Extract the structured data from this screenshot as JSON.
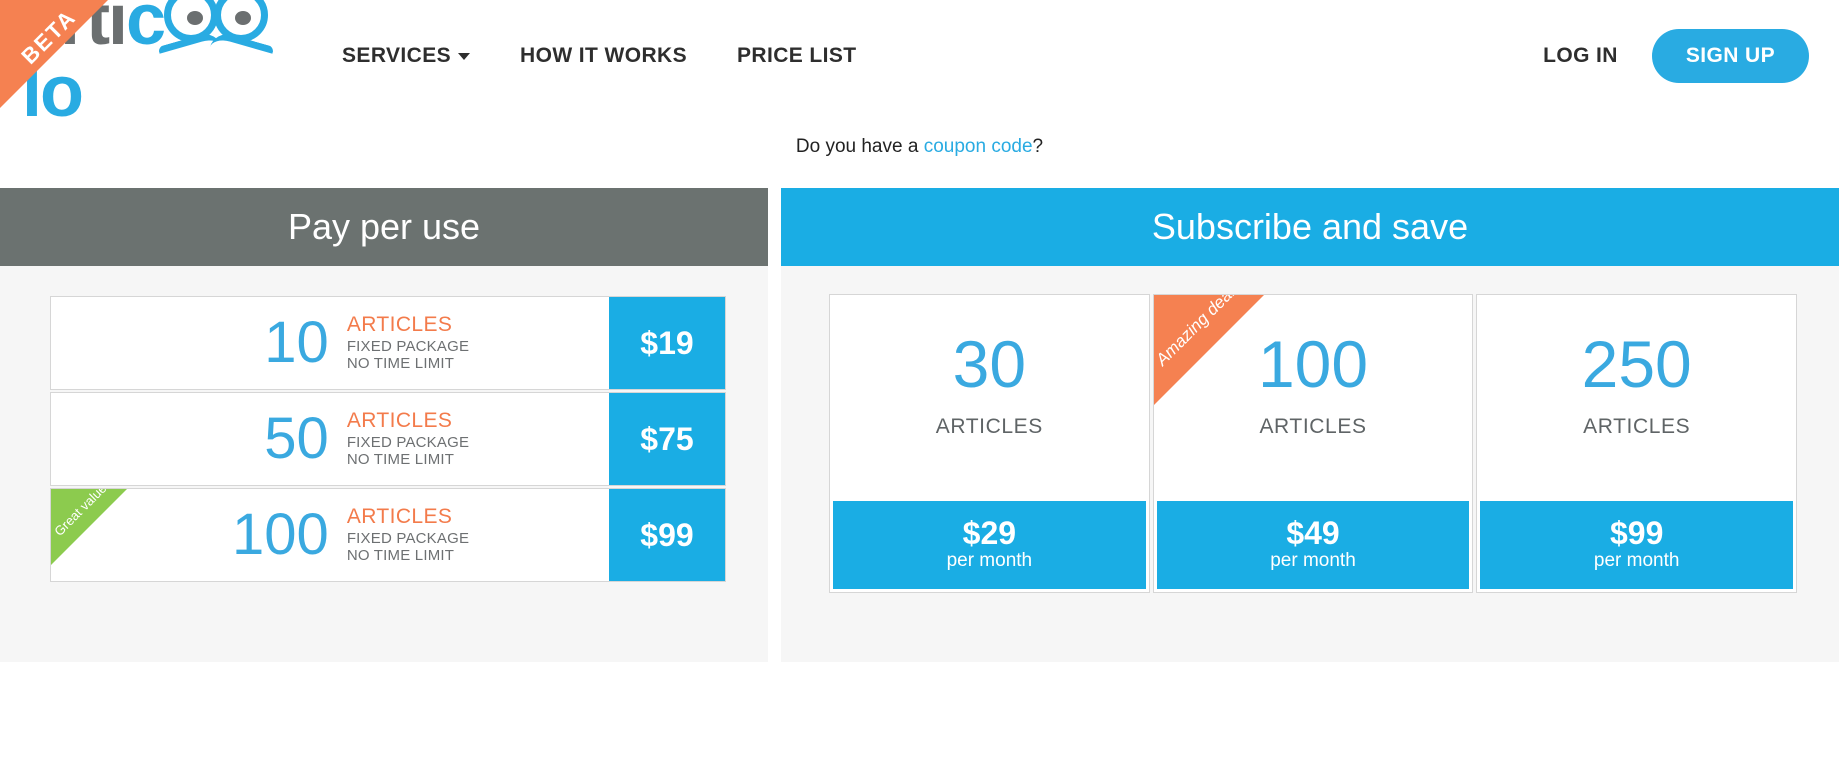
{
  "header": {
    "beta_badge": "BETA",
    "logo": {
      "part1": "arti",
      "part2": "c",
      "part3": "lo",
      "alt": "articoolo"
    },
    "nav": [
      {
        "label": "SERVICES",
        "has_dropdown": true
      },
      {
        "label": "HOW IT WORKS",
        "has_dropdown": false
      },
      {
        "label": "PRICE LIST",
        "has_dropdown": false
      }
    ],
    "login_label": "LOG IN",
    "signup_label": "SIGN UP"
  },
  "coupon": {
    "prefix": "Do you have a ",
    "link": "coupon code",
    "suffix": "?"
  },
  "pay_per_use": {
    "title": "Pay per use",
    "rows": [
      {
        "count": "10",
        "articles": "ARTICLES",
        "line1": "FIXED PACKAGE",
        "line2": "NO TIME LIMIT",
        "price": "$19",
        "badge": ""
      },
      {
        "count": "50",
        "articles": "ARTICLES",
        "line1": "FIXED PACKAGE",
        "line2": "NO TIME LIMIT",
        "price": "$75",
        "badge": ""
      },
      {
        "count": "100",
        "articles": "ARTICLES",
        "line1": "FIXED PACKAGE",
        "line2": "NO TIME LIMIT",
        "price": "$99",
        "badge": "Great value"
      }
    ]
  },
  "subscribe": {
    "title": "Subscribe and save",
    "cards": [
      {
        "count": "30",
        "articles": "ARTICLES",
        "price": "$29",
        "period": "per month",
        "badge": ""
      },
      {
        "count": "100",
        "articles": "ARTICLES",
        "price": "$49",
        "period": "per month",
        "badge": "Amazing deal!"
      },
      {
        "count": "250",
        "articles": "ARTICLES",
        "price": "$99",
        "period": "per month",
        "badge": ""
      }
    ]
  },
  "colors": {
    "brand_blue": "#29abe2",
    "price_blue": "#1aade4",
    "orange": "#f58151",
    "articles_orange": "#f37b4b",
    "gray_header": "#6b7270",
    "green": "#8ccb4e"
  }
}
